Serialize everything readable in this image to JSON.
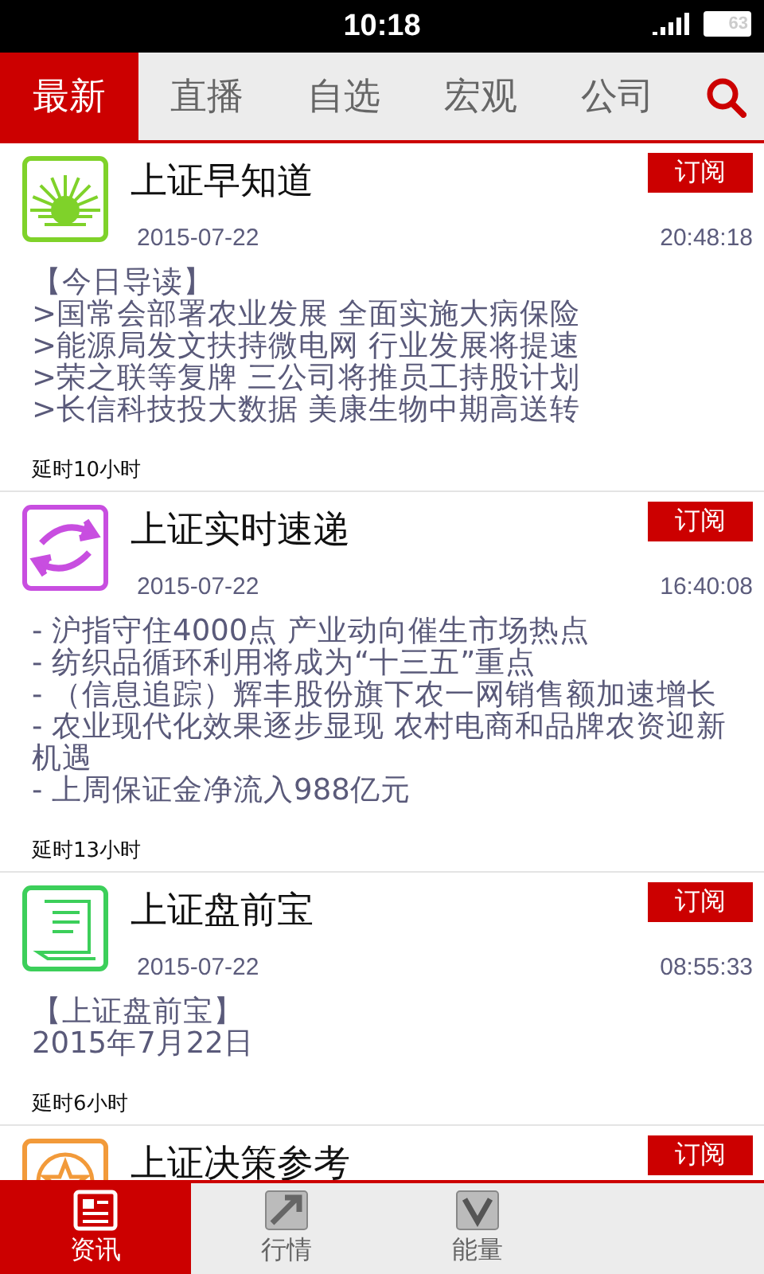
{
  "status_bar": {
    "time": "10:18",
    "battery": "63"
  },
  "top_tabs": [
    {
      "label": "最新",
      "selected": true
    },
    {
      "label": "直播",
      "selected": false
    },
    {
      "label": "自选",
      "selected": false
    },
    {
      "label": "宏观",
      "selected": false
    },
    {
      "label": "公司",
      "selected": false
    }
  ],
  "feeds": [
    {
      "kind": "sunrise",
      "title": "上证早知道",
      "button": "订阅",
      "date": "2015-07-22",
      "time": "20:48:18",
      "body": [
        "【今日导读】",
        ">国常会部署农业发展 全面实施大病保险",
        ">能源局发文扶持微电网 行业发展将提速",
        ">荣之联等复牌 三公司将推员工持股计划",
        ">长信科技投大数据 美康生物中期高送转"
      ],
      "delay": "延时10小时"
    },
    {
      "kind": "cycle",
      "title": "上证实时速递",
      "button": "订阅",
      "date": "2015-07-22",
      "time": "16:40:08",
      "body": [
        "- 沪指守住4000点 产业动向催生市场热点",
        "- 纺织品循环利用将成为“十三五”重点",
        "- （信息追踪）辉丰股份旗下农一网销售额加速增长",
        "- 农业现代化效果逐步显现 农村电商和品牌农资迎新机遇",
        "- 上周保证金净流入988亿元"
      ],
      "delay": "延时13小时"
    },
    {
      "kind": "scroll",
      "title": "上证盘前宝",
      "button": "订阅",
      "date": "2015-07-22",
      "time": "08:55:33",
      "body": [
        "【上证盘前宝】",
        "2015年7月22日"
      ],
      "delay": "延时6小时"
    },
    {
      "kind": "star",
      "title": "上证决策参考",
      "button": "订阅"
    }
  ],
  "bottom_tabs": [
    {
      "kind": "news",
      "label": "资讯",
      "selected": true
    },
    {
      "kind": "trend",
      "label": "行情",
      "selected": false
    },
    {
      "kind": "check",
      "label": "能量",
      "selected": false
    }
  ]
}
